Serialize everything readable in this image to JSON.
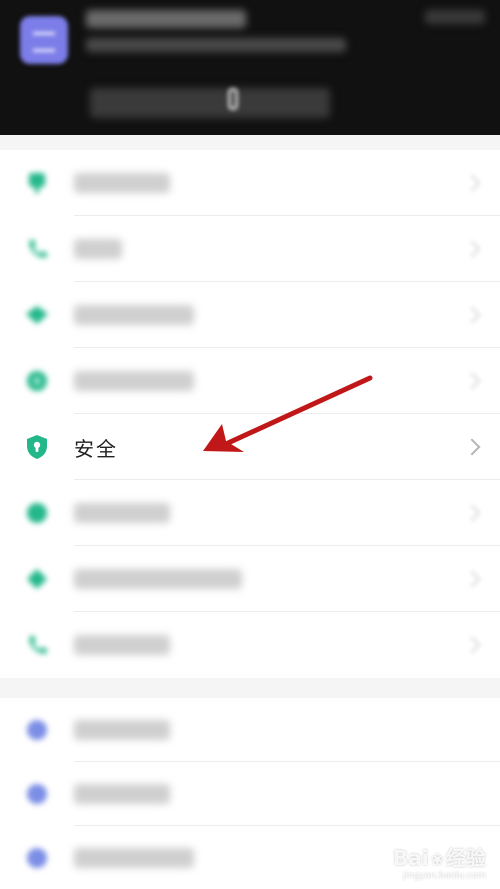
{
  "colors": {
    "accent": "#23b78a",
    "blue_icon": "#7b8ee6",
    "arrow": "#c01818",
    "header_bg": "#111111"
  },
  "settings": {
    "security_label": "安全"
  },
  "watermark": {
    "brand": "Bai",
    "brand2": "经验",
    "url": "jingyan.baidu.com"
  }
}
